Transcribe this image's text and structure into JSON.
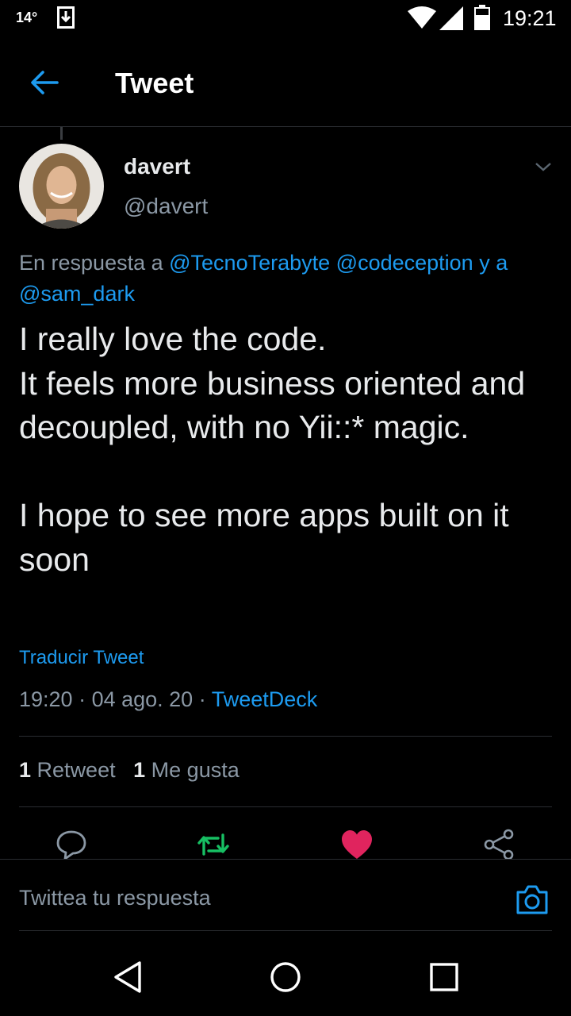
{
  "status_bar": {
    "temperature": "14°",
    "time": "19:21"
  },
  "header": {
    "title": "Tweet"
  },
  "author": {
    "name": "davert",
    "handle": "@davert"
  },
  "reply_to": {
    "prefix": "En respuesta a ",
    "mentions": [
      "@TecnoTerabyte",
      "@codeception"
    ],
    "join": " y a ",
    "last_mention": "@sam_dark"
  },
  "tweet": {
    "text": "I really love the code.\nIt feels more business oriented and decoupled, with no Yii::* magic.\n\nI hope to see more apps built on it soon",
    "translate_label": "Traducir Tweet",
    "time": "19:20",
    "date": "04 ago. 20",
    "separator": " · ",
    "source": "TweetDeck"
  },
  "stats": {
    "retweets_count": "1",
    "retweets_label": "Retweet",
    "likes_count": "1",
    "likes_label": "Me gusta"
  },
  "compose": {
    "placeholder": "Twittea tu respuesta"
  },
  "colors": {
    "accent": "#1d9bf0",
    "retweet_active": "#17bf63",
    "like_active": "#e0245e",
    "background": "#000000",
    "secondary_text": "#8b98a5"
  },
  "icons": {
    "status": [
      "download-icon",
      "wifi-icon",
      "signal-icon",
      "battery-icon"
    ],
    "actions": [
      "reply-icon",
      "retweet-icon",
      "like-icon",
      "share-icon"
    ],
    "nav": [
      "nav-back-icon",
      "nav-home-icon",
      "nav-recents-icon"
    ]
  }
}
